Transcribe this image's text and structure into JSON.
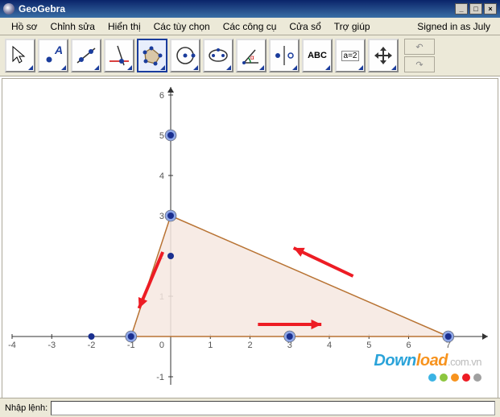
{
  "app": {
    "title": "GeoGebra"
  },
  "winbtns": {
    "min": "_",
    "max": "□",
    "close": "×"
  },
  "menu": {
    "items": [
      "Hồ sơ",
      "Chỉnh sửa",
      "Hiển thị",
      "Các tùy chọn",
      "Các công cụ",
      "Cửa sổ",
      "Trợ giúp"
    ],
    "signin": "Signed in as July"
  },
  "toolbar": {
    "selected_index": 4,
    "tools": [
      {
        "name": "move",
        "label": "Move"
      },
      {
        "name": "point",
        "label": "A",
        "color": "#1a3c9c"
      },
      {
        "name": "line-two-points"
      },
      {
        "name": "perpendicular"
      },
      {
        "name": "polygon"
      },
      {
        "name": "circle-center"
      },
      {
        "name": "ellipse"
      },
      {
        "name": "angle"
      },
      {
        "name": "reflect"
      },
      {
        "name": "text",
        "label": "ABC"
      },
      {
        "name": "slider",
        "label": "a=2"
      },
      {
        "name": "move-view"
      }
    ],
    "undo": "↶",
    "redo": "↷"
  },
  "inputbar": {
    "label": "Nhập lệnh:",
    "value": ""
  },
  "watermark": {
    "part1": "Down",
    "part2": "load",
    "part3": ".com.vn",
    "dot_colors": [
      "#3bb3e4",
      "#8cc63f",
      "#f7931e",
      "#ed1c24",
      "#a0a0a0"
    ]
  },
  "chart_data": {
    "type": "scatter",
    "xlim": [
      -4,
      8
    ],
    "ylim": [
      -1.2,
      6.2
    ],
    "xticks": [
      -4,
      -3,
      -2,
      -1,
      0,
      1,
      2,
      3,
      4,
      5,
      6,
      7
    ],
    "yticks": [
      -1,
      0,
      1,
      2,
      3,
      4,
      5,
      6
    ],
    "polygon": {
      "vertices": [
        [
          0,
          3
        ],
        [
          7,
          0
        ],
        [
          -1,
          0
        ]
      ],
      "fill": "#f6e7e1",
      "stroke": "#b87333"
    },
    "points_large": [
      [
        0,
        5
      ],
      [
        0,
        3
      ],
      [
        -1,
        0
      ],
      [
        7,
        0
      ],
      [
        3,
        0
      ]
    ],
    "points_small": [
      [
        0,
        2
      ],
      [
        -2,
        0
      ]
    ],
    "arrows": [
      {
        "from": [
          4.6,
          1.5
        ],
        "to": [
          3.1,
          2.2
        ],
        "color": "#ed1c24"
      },
      {
        "from": [
          -0.2,
          2.1
        ],
        "to": [
          -0.8,
          0.7
        ],
        "color": "#ed1c24"
      },
      {
        "from": [
          2.2,
          0.3
        ],
        "to": [
          3.8,
          0.3
        ],
        "color": "#ed1c24"
      }
    ]
  }
}
